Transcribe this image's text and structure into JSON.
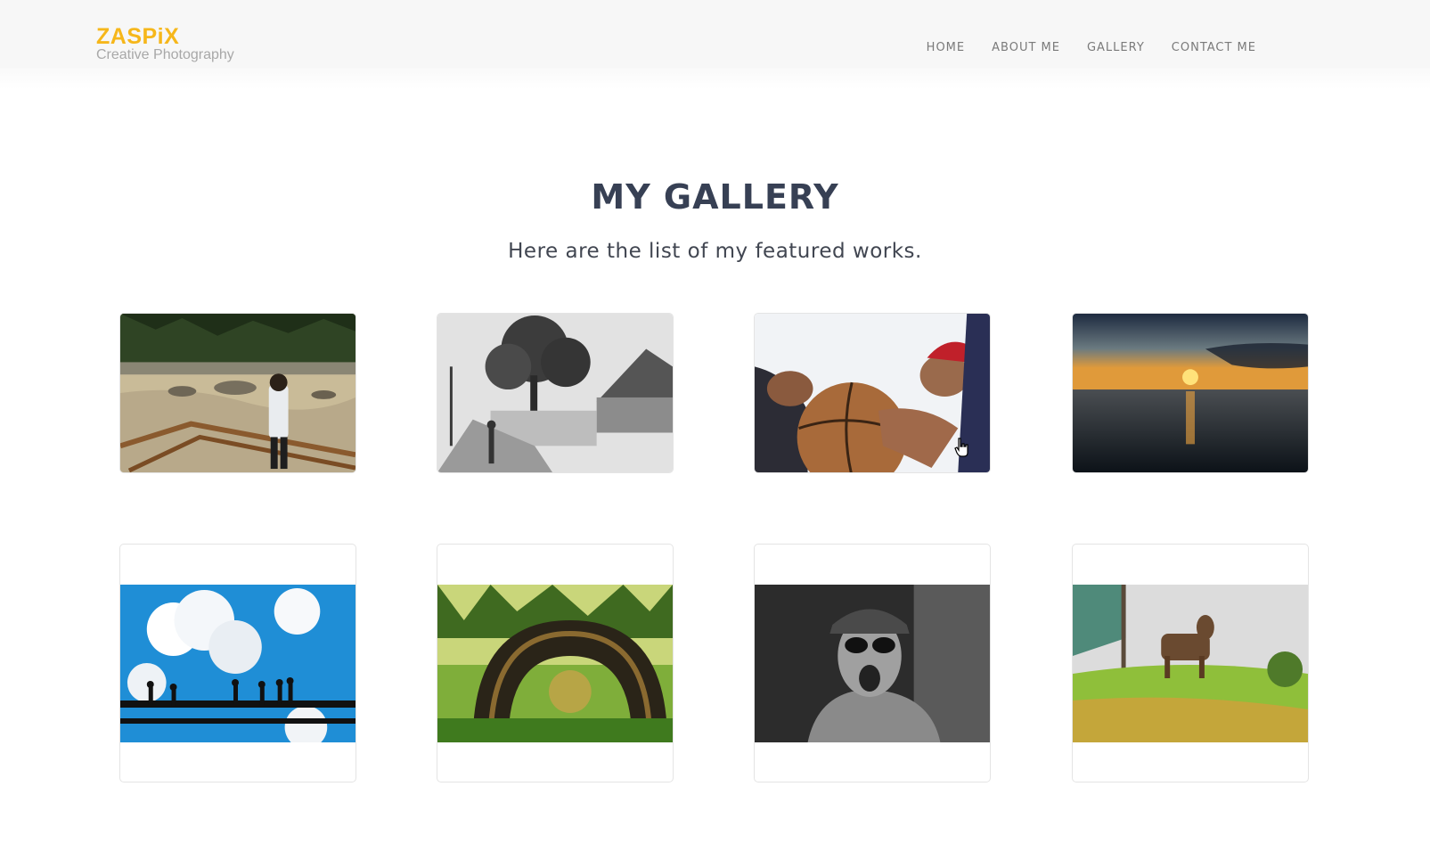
{
  "brand": {
    "name": "ZASPiX",
    "tagline": "Creative Photography",
    "color": "#f6b71b"
  },
  "nav": {
    "items": [
      "HOME",
      "ABOUT ME",
      "GALLERY",
      "CONTACT ME"
    ]
  },
  "section": {
    "title": "MY GALLERY",
    "subtitle": "Here are the list of my featured works."
  },
  "gallery": {
    "photos": [
      {
        "icon": "river-photo"
      },
      {
        "icon": "street-photo"
      },
      {
        "icon": "basketball-photo"
      },
      {
        "icon": "sunset-photo"
      },
      {
        "icon": "bridge-sky-photo"
      },
      {
        "icon": "tire-photo"
      },
      {
        "icon": "old-man-photo"
      },
      {
        "icon": "goat-photo"
      }
    ]
  },
  "colors": {
    "title": "#374054",
    "nav": "#7a7a7a",
    "background": "#ffffff"
  }
}
